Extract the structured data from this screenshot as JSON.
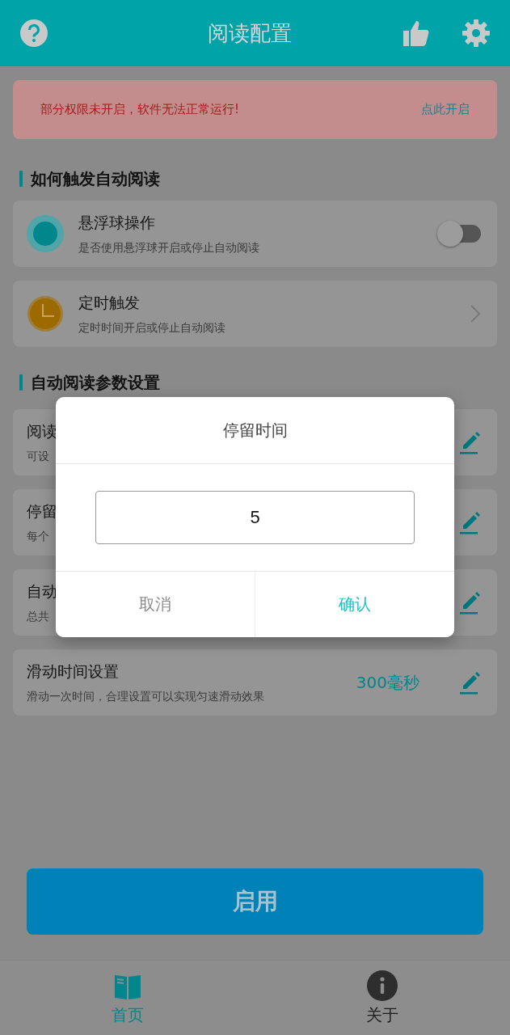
{
  "header": {
    "title": "阅读配置"
  },
  "alert": {
    "message": "部分权限未开启，软件无法正常运行!",
    "action": "点此开启"
  },
  "sections": [
    {
      "title": "如何触发自动阅读",
      "items": [
        {
          "kind": "switch",
          "title": "悬浮球操作",
          "subtitle": "是否使用悬浮球开启或停止自动阅读",
          "on": false
        },
        {
          "kind": "link",
          "title": "定时触发",
          "subtitle": "定时时间开启或停止自动阅读"
        }
      ]
    },
    {
      "title": "自动阅读参数设置",
      "items": [
        {
          "kind": "edit",
          "title": "阅读",
          "subtitle": "可设"
        },
        {
          "kind": "edit",
          "title": "停留",
          "subtitle": "每个"
        },
        {
          "kind": "edit",
          "title": "自动",
          "subtitle": "总共"
        },
        {
          "kind": "edit",
          "title": "滑动时间设置",
          "subtitle": "滑动一次时间，合理设置可以实现匀速滑动效果",
          "value": "300毫秒"
        }
      ]
    }
  ],
  "primary_button": "启用",
  "tabs": [
    {
      "label": "首页",
      "selected": true,
      "kind": "home"
    },
    {
      "label": "关于",
      "selected": false,
      "kind": "about"
    }
  ],
  "dialog": {
    "title": "停留时间",
    "value": "5",
    "buttons": [
      {
        "label": "取消",
        "kind": "cancel"
      },
      {
        "label": "确认",
        "kind": "confirm"
      }
    ]
  }
}
